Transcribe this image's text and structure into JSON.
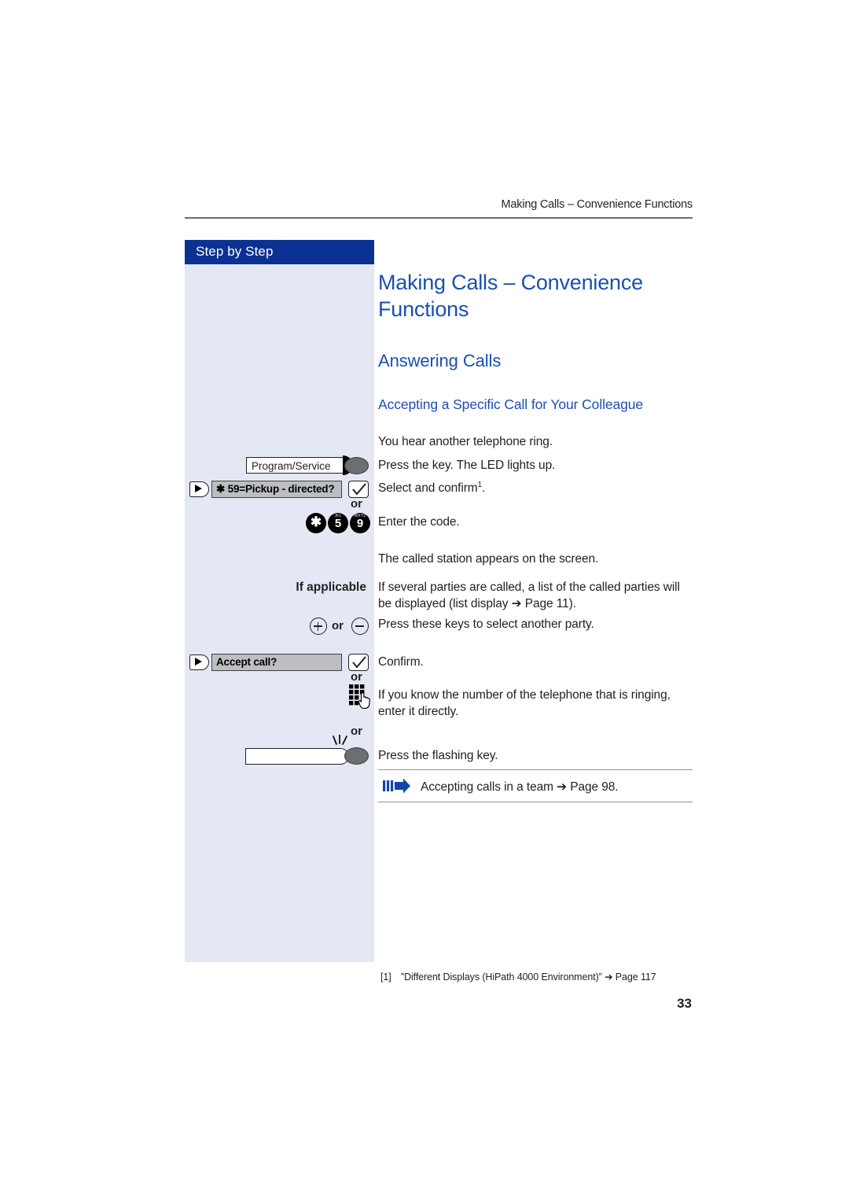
{
  "header": {
    "running_title": "Making Calls – Convenience Functions"
  },
  "sidebar": {
    "banner_label": "Step by Step",
    "rows": {
      "program_service_key": "Program/Service",
      "pickup_directed_display": "✱ 59=Pickup - directed?",
      "or_1": "or",
      "dial_digits": [
        {
          "num": "✱",
          "letters": ""
        },
        {
          "num": "5",
          "letters": "JKL"
        },
        {
          "num": "9",
          "letters": "WXYZ"
        }
      ],
      "if_applicable_label": "If applicable",
      "plus_minus_or": "or",
      "accept_call_display": "Accept call?",
      "or_2": "or",
      "or_3": "or"
    }
  },
  "main": {
    "heading_1": "Making Calls – Convenience Functions",
    "heading_2": "Answering Calls",
    "heading_3": "Accepting a Specific Call for Your Colleague",
    "lines": {
      "hear_ring": "You hear another telephone ring.",
      "press_key_led": "Press the key. The LED lights up.",
      "select_confirm": "Select and confirm",
      "select_confirm_footnote": "1",
      "select_confirm_end": ".",
      "enter_code": "Enter the code.",
      "called_station": "The called station appears on the screen.",
      "several_parties": "If several parties are called, a list of the called parties will be displayed (list display ➔ Page 11).",
      "press_keys_select": "Press these keys to select another party.",
      "confirm": "Confirm.",
      "know_number": "If you know the number of the telephone that is ringing, enter it directly.",
      "press_flashing": "Press the flashing key."
    },
    "cross_reference": "Accepting calls in a team ➔ Page 98."
  },
  "footer": {
    "footnote_marker": "[1]",
    "footnote_text": "”Different Displays (HiPath 4000 Environment)” ➔ Page 117",
    "page_number": "33"
  },
  "colors": {
    "banner_blue": "#0b3293",
    "heading_blue": "#1c4fb0",
    "sidebar_bg": "#e4e8f4",
    "lcd_gray": "#bcbec0",
    "led_gray": "#6d6e71",
    "rule_gray": "#939598",
    "text_black": "#231f20"
  }
}
